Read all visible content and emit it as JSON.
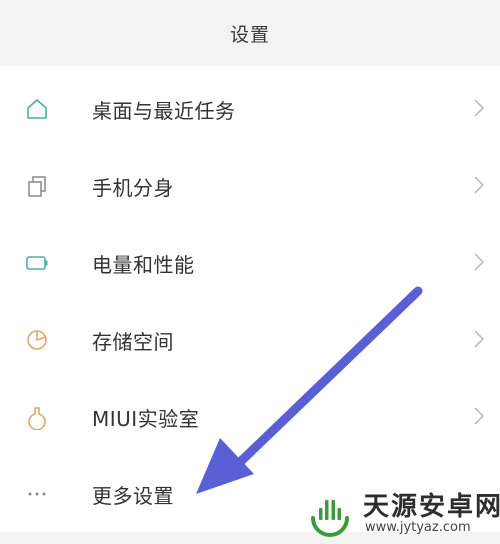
{
  "header": {
    "title": "设置"
  },
  "items": [
    {
      "label": "桌面与最近任务",
      "icon": "home-icon"
    },
    {
      "label": "手机分身",
      "icon": "copy-icon"
    },
    {
      "label": "电量和性能",
      "icon": "battery-icon"
    },
    {
      "label": "存储空间",
      "icon": "pie-chart-icon"
    },
    {
      "label": "MIUI实验室",
      "icon": "flask-icon"
    },
    {
      "label": "更多设置",
      "icon": "more-dots-icon"
    }
  ],
  "annotation": {
    "arrow_color": "#5b5fd6"
  },
  "watermark": {
    "title": "天源安卓网",
    "url": "www.jytyaz.com",
    "accent": "#3d9a3a"
  },
  "colors": {
    "icon_teal": "#47b3a6",
    "icon_orange": "#e8a56a",
    "text": "#333333",
    "chevron": "#bdbdbd",
    "header_bg": "#f3f3f3"
  }
}
